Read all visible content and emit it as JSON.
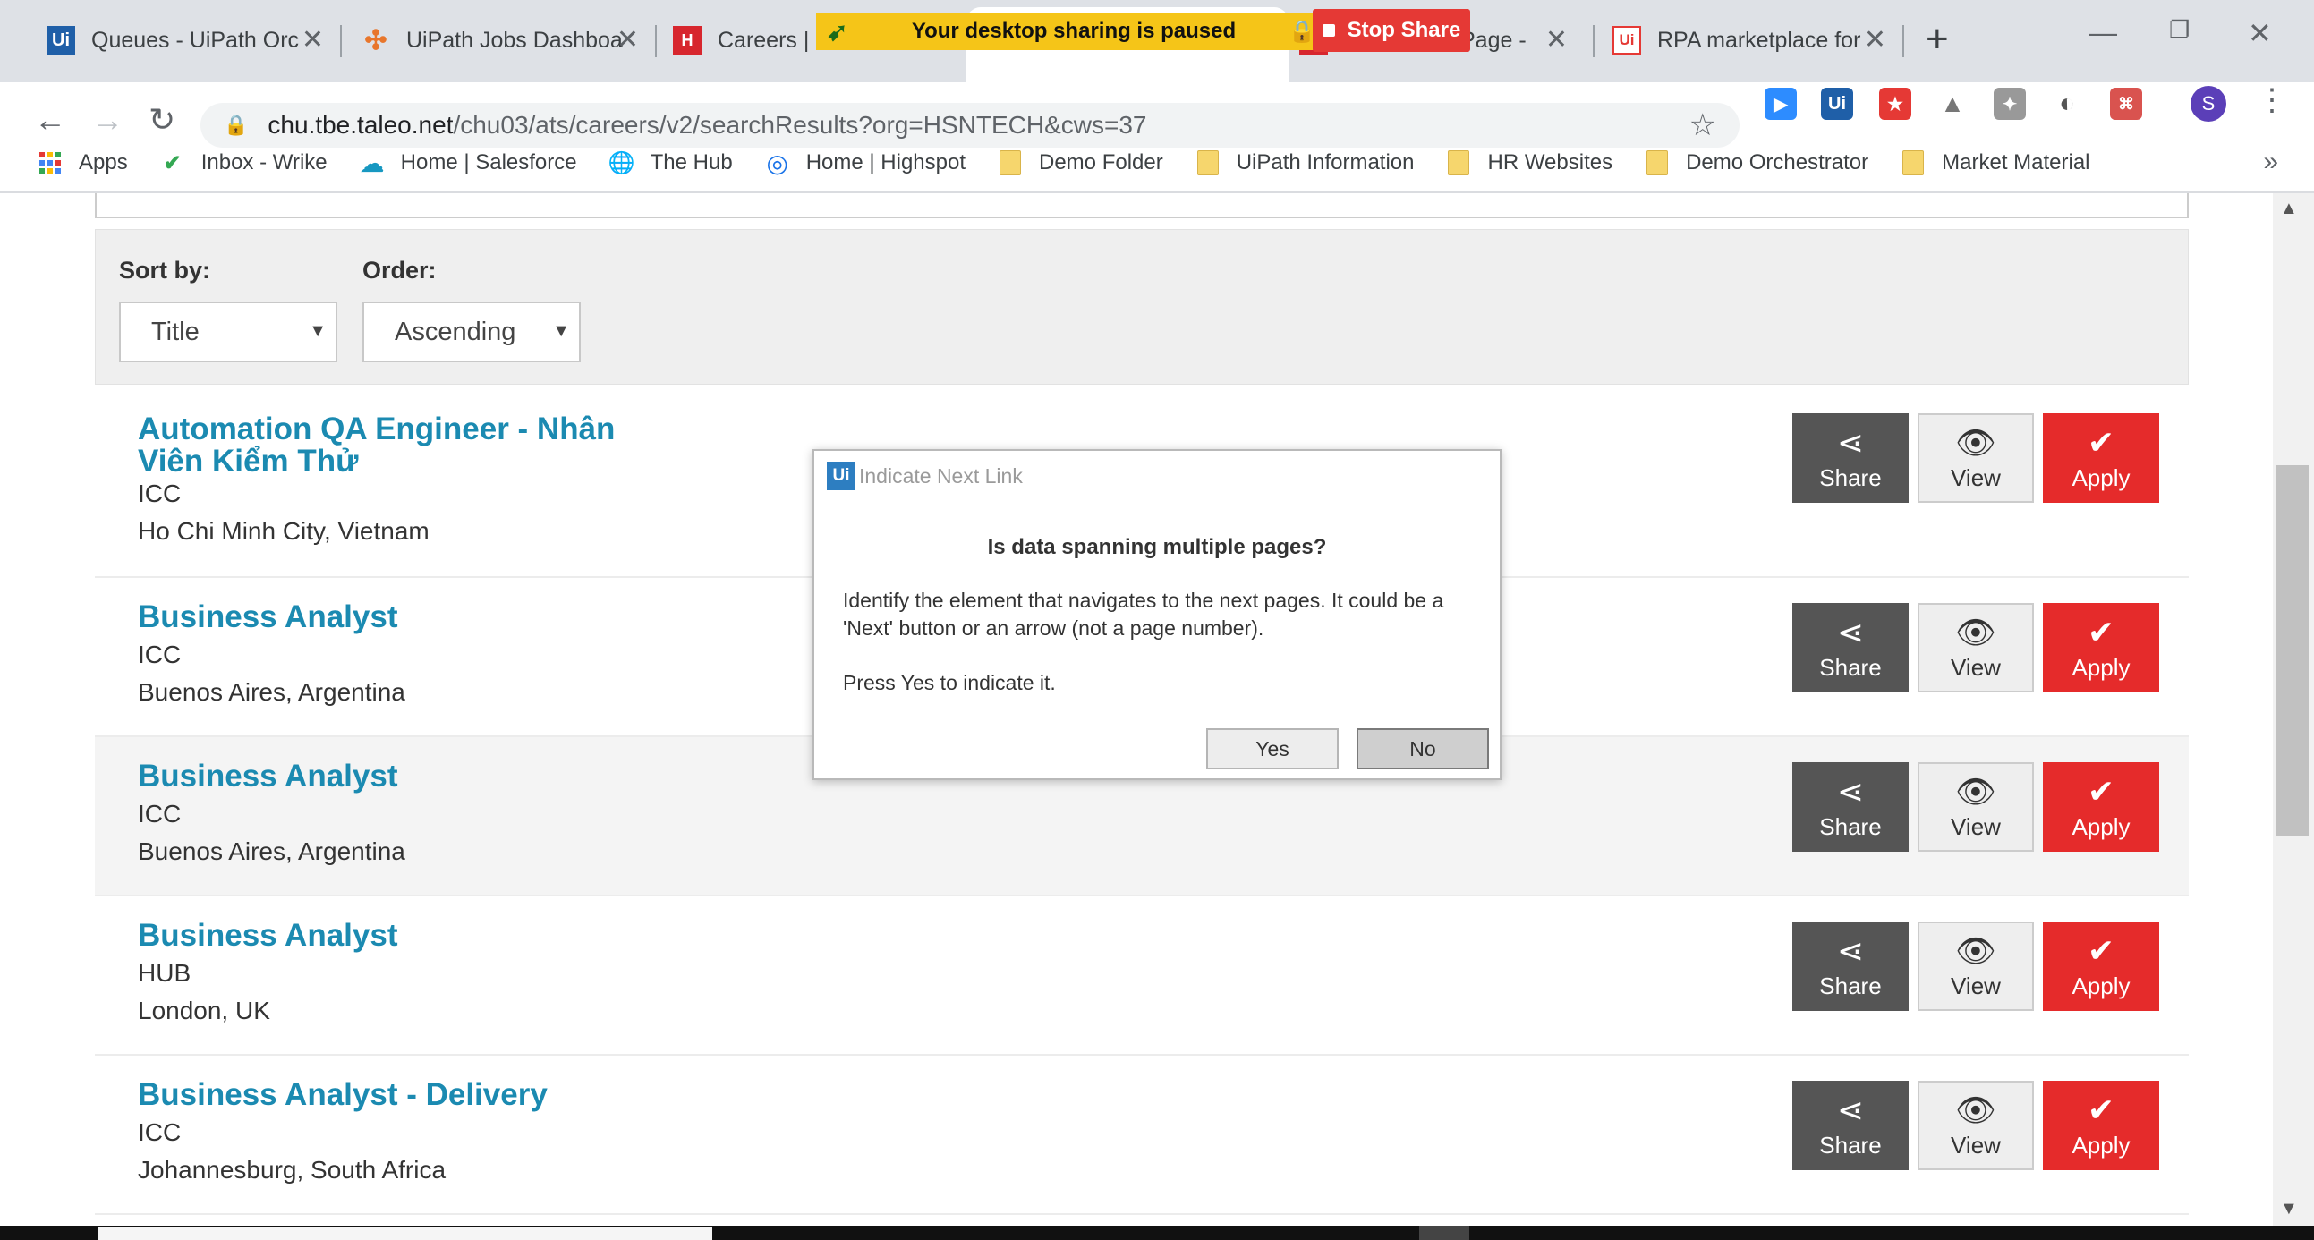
{
  "tabs": [
    {
      "title": "Queues - UiPath Orc",
      "icon": "uipath-icon"
    },
    {
      "title": "UiPath Jobs Dashboa",
      "icon": "tableau-icon"
    },
    {
      "title": "Careers | H",
      "icon": "hsn-icon"
    },
    {
      "title": "Page -",
      "icon": "page-icon"
    },
    {
      "title": "RPA marketplace for",
      "icon": "uipath-red-icon"
    }
  ],
  "share_banner": {
    "message": "Your desktop sharing is paused",
    "stop_label": "Stop Share"
  },
  "address": {
    "host": "chu.tbe.taleo.net",
    "path": "/chu03/ats/careers/v2/searchResults?org=HSNTECH&cws=37"
  },
  "profile_initial": "S",
  "bookmarks": [
    {
      "label": "Apps",
      "icon": "apps-grid-icon"
    },
    {
      "label": "Inbox - Wrike",
      "icon": "wrike-check-icon"
    },
    {
      "label": "Home | Salesforce",
      "icon": "salesforce-cloud-icon"
    },
    {
      "label": "The Hub",
      "icon": "globe-icon"
    },
    {
      "label": "Home | Highspot",
      "icon": "highspot-icon"
    },
    {
      "label": "Demo Folder",
      "icon": "folder-icon"
    },
    {
      "label": "UiPath Information",
      "icon": "folder-icon"
    },
    {
      "label": "HR Websites",
      "icon": "folder-icon"
    },
    {
      "label": "Demo Orchestrator",
      "icon": "folder-icon"
    },
    {
      "label": "Market Material",
      "icon": "folder-icon"
    }
  ],
  "sort": {
    "sort_label": "Sort by:",
    "sort_value": "Title",
    "order_label": "Order:",
    "order_value": "Ascending"
  },
  "jobs": [
    {
      "title": "Automation QA Engineer - Nhân Viên Kiểm Thử",
      "dept": "ICC",
      "location": "Ho Chi Minh City, Vietnam"
    },
    {
      "title": "Business Analyst",
      "dept": "ICC",
      "location": "Buenos Aires, Argentina"
    },
    {
      "title": "Business Analyst",
      "dept": "ICC",
      "location": "Buenos Aires, Argentina"
    },
    {
      "title": "Business Analyst",
      "dept": "HUB",
      "location": "London, UK"
    },
    {
      "title": "Business Analyst - Delivery",
      "dept": "ICC",
      "location": "Johannesburg, South Africa"
    }
  ],
  "job_buttons": {
    "share": "Share",
    "view": "View",
    "apply": "Apply"
  },
  "dialog": {
    "logo": "Ui",
    "title": "Indicate Next Link",
    "question": "Is data spanning multiple pages?",
    "body": "Identify the element that navigates to the next pages. It could be a 'Next' button or an arrow (not a page number).",
    "body2": "Press Yes to indicate it.",
    "yes": "Yes",
    "no": "No"
  },
  "colors": {
    "link": "#1b8ab1",
    "apply": "#e52b2b",
    "share": "#555555",
    "banner": "#f5c518",
    "stop": "#e53935"
  }
}
